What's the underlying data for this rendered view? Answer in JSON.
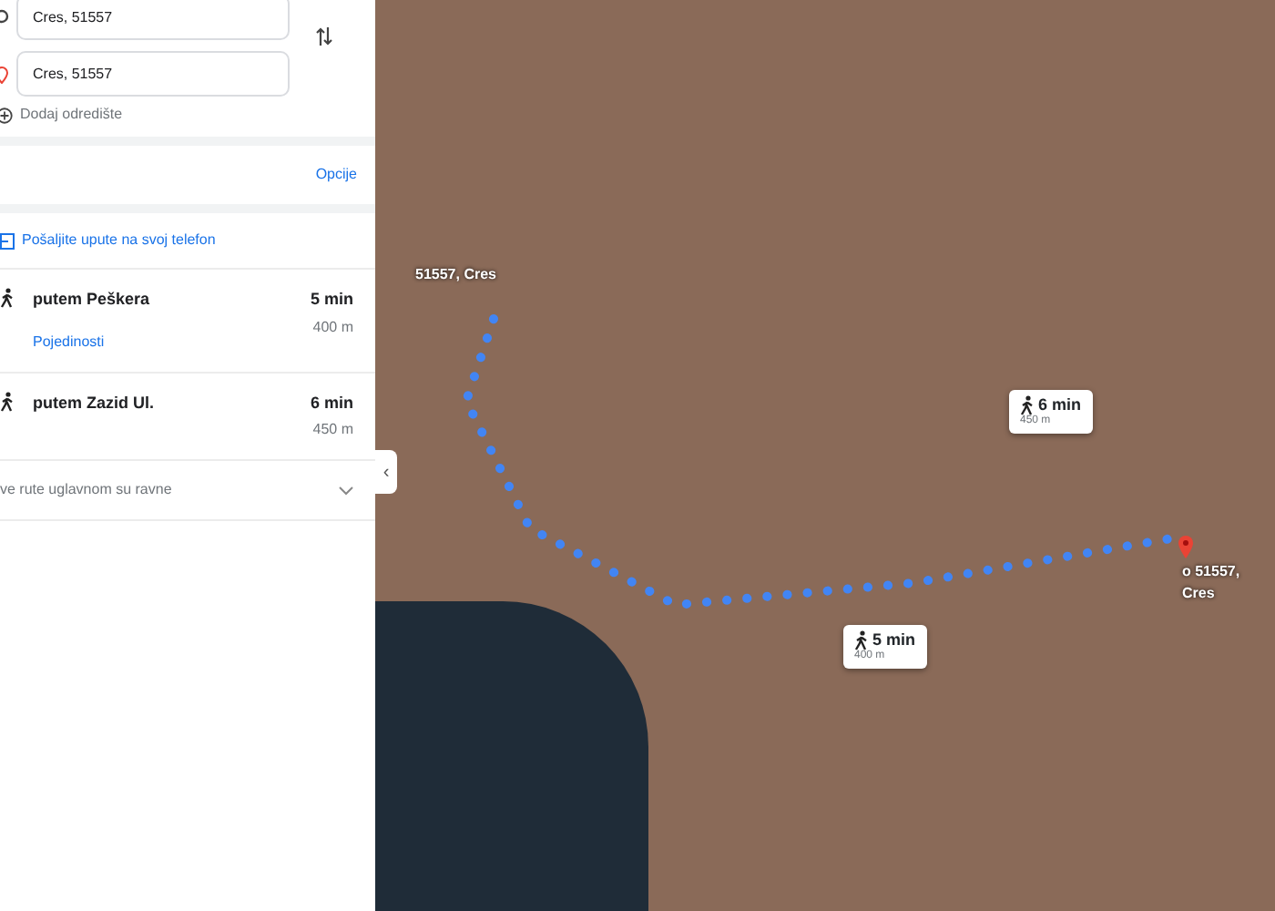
{
  "directions": {
    "origin": {
      "value": "Cres, 51557"
    },
    "destination": {
      "value": "Cres, 51557"
    },
    "add_destination": "Dodaj odredište",
    "options_link": "Opcije",
    "send_to_phone": "Pošaljite upute na svoj telefon"
  },
  "routes": [
    {
      "name": "putem Peškera",
      "time": "5 min",
      "distance": "400 m",
      "details_link": "Pojedinosti"
    },
    {
      "name": "putem Zazid Ul.",
      "time": "6 min",
      "distance": "450 m"
    }
  ],
  "footer_note": "ve rute uglavnom su ravne",
  "collapse_button": "‹",
  "map": {
    "callouts": [
      {
        "time": "6 min",
        "distance": "450 m"
      },
      {
        "time": "5 min",
        "distance": "400 m"
      }
    ],
    "destination_label": "o 51557, Cres",
    "origin_label": "51557, Cres"
  }
}
